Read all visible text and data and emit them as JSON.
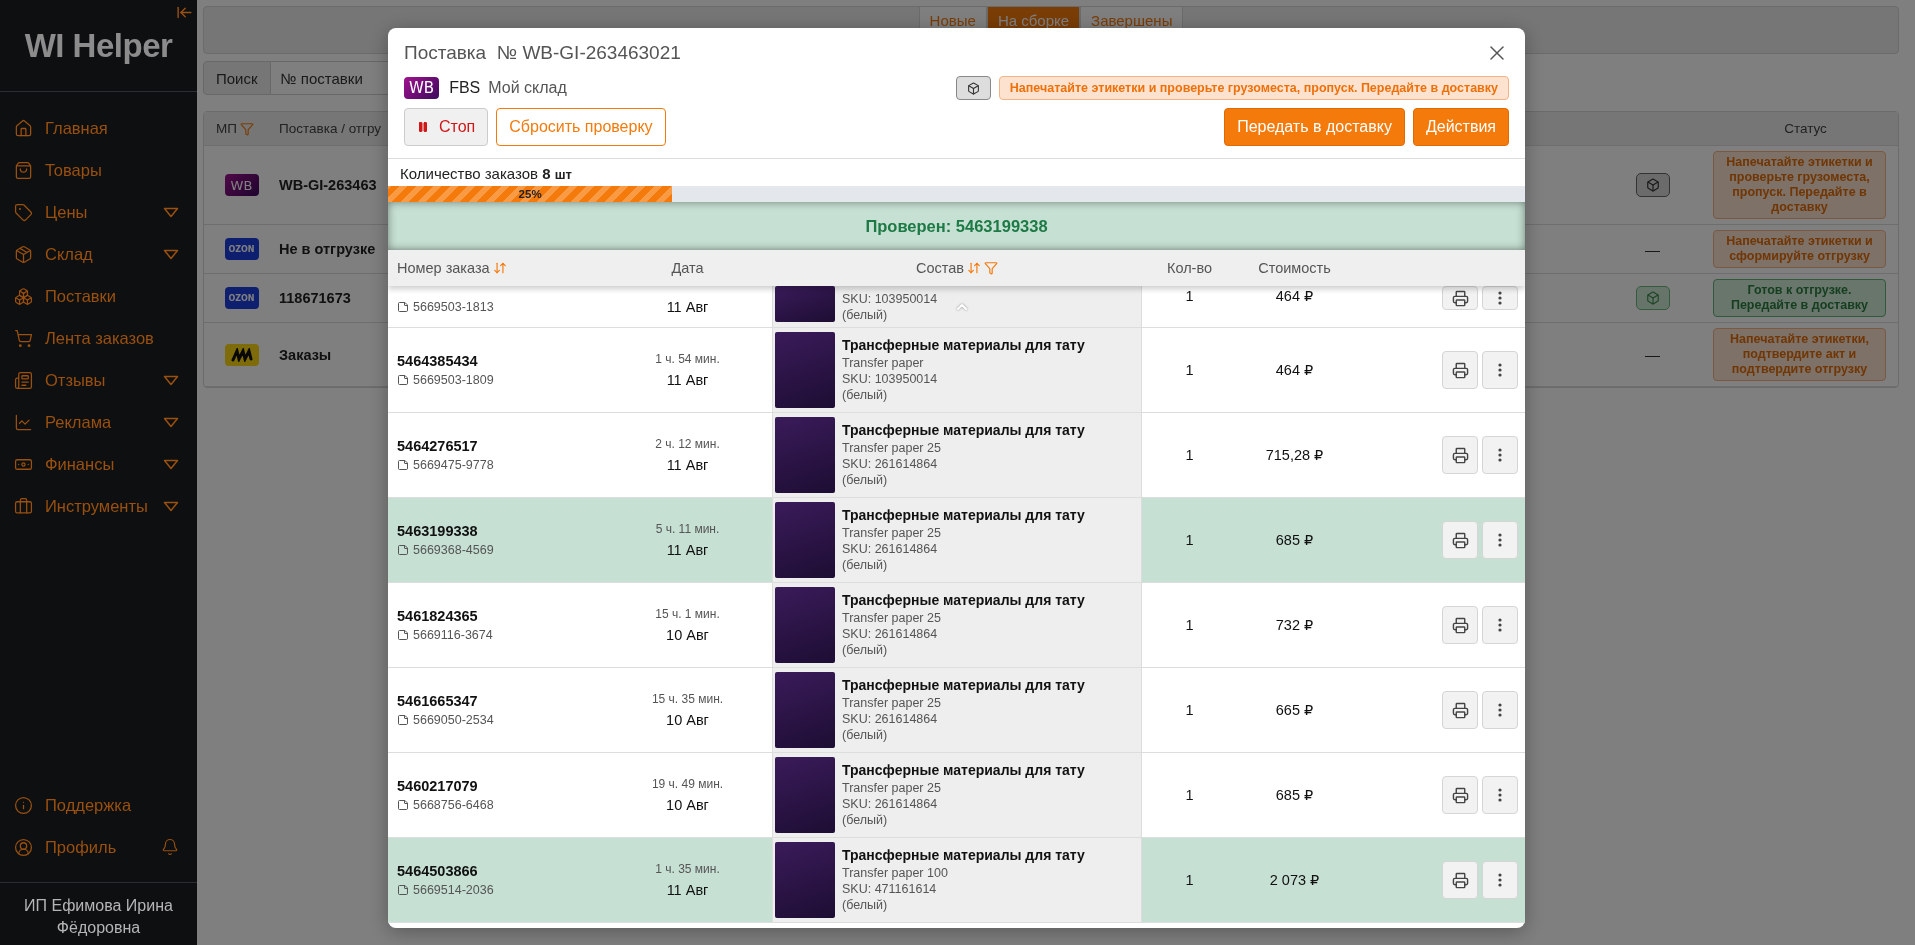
{
  "sidebar": {
    "logo": "WI Helper",
    "items": [
      {
        "label": "Главная",
        "expandable": false
      },
      {
        "label": "Товары",
        "expandable": false
      },
      {
        "label": "Цены",
        "expandable": true
      },
      {
        "label": "Склад",
        "expandable": true
      },
      {
        "label": "Поставки",
        "expandable": false
      },
      {
        "label": "Лента заказов",
        "expandable": false
      },
      {
        "label": "Отзывы",
        "expandable": true
      },
      {
        "label": "Реклама",
        "expandable": true
      },
      {
        "label": "Финансы",
        "expandable": true
      },
      {
        "label": "Инструменты",
        "expandable": true
      }
    ],
    "bottom_items": [
      {
        "label": "Поддержка",
        "bell": false
      },
      {
        "label": "Профиль",
        "bell": true
      }
    ],
    "user": "ИП Ефимова Ирина Фёдоровна"
  },
  "background": {
    "tabs": [
      {
        "label": "Новые",
        "selected": false
      },
      {
        "label": "На сборке",
        "selected": true
      },
      {
        "label": "Завершены",
        "selected": false
      }
    ],
    "search": {
      "button": "Поиск",
      "placeholder": "№ поставки"
    },
    "columns": [
      "МП",
      "Поставка / отгру",
      "Статус"
    ],
    "rows": [
      {
        "logo": {
          "kind": "wb",
          "text": "WB"
        },
        "name": "WB-GI-263463",
        "shipment": {
          "kind": "box"
        },
        "status": {
          "kind": "warning",
          "text": "Напечатайте этикетки и проверьте грузоместа, пропуск. Передайте в доставку"
        }
      },
      {
        "logo": {
          "kind": "ozon",
          "text": "OZON"
        },
        "name": "Не в отгрузке",
        "shipment": {
          "kind": "dash",
          "text": "—"
        },
        "status": {
          "kind": "warning",
          "text": "Напечатайте этикетки и сформируйте отгрузку"
        }
      },
      {
        "logo": {
          "kind": "ozon",
          "text": "OZON"
        },
        "name": "118671673",
        "shipment": {
          "kind": "box"
        },
        "status": {
          "kind": "ready",
          "text": "Готов к отгрузке. Передайте в доставку"
        }
      },
      {
        "logo": {
          "kind": "yandex"
        },
        "name": "Заказы",
        "shipment": {
          "kind": "dash",
          "text": "—"
        },
        "status": {
          "kind": "warning",
          "text": "Напечатайте этикетки, подтвердите акт и подтвердите отгрузку"
        }
      }
    ]
  },
  "modal": {
    "title": "Поставка  № WB-GI-263463021",
    "marketplace": {
      "logo": "WB",
      "scheme": "FBS",
      "warehouse": "Мой склад"
    },
    "alert": "Напечатайте этикетки и проверьте грузоместа, пропуск. Передайте в доставку",
    "buttons_left": [
      {
        "kind": "stop",
        "label": "Стоп"
      },
      {
        "kind": "outline",
        "label": "Сбросить проверку"
      }
    ],
    "buttons_right": [
      {
        "kind": "primary",
        "label": "Передать в доставку"
      },
      {
        "kind": "primary",
        "label": "Действия"
      }
    ],
    "count": {
      "label": "Количество заказов",
      "value": "8",
      "unit": "шт"
    },
    "progress": {
      "level": 0.25,
      "label": "25%"
    },
    "banner": "Проверен: 5463199338",
    "columns": [
      {
        "label": "Номер заказа",
        "sortable": true,
        "filterable": false
      },
      {
        "label": "Дата",
        "sortable": false,
        "filterable": false
      },
      {
        "label": "Состав",
        "sortable": true,
        "filterable": true
      },
      {
        "label": "Кол-во",
        "sortable": false,
        "filterable": false
      },
      {
        "label": "Стоимость",
        "sortable": false,
        "filterable": false
      }
    ],
    "rows": [
      {
        "kind": "partial",
        "checked": false,
        "sub": "5669503-1813",
        "date": "11 Авг",
        "lines": [
          "SKU: 103950014",
          "(белый)"
        ],
        "qty": "1",
        "price": "464 ₽"
      },
      {
        "kind": "full",
        "checked": false,
        "number": "5464385434",
        "sub": "5669503-1809",
        "time": "1 ч. 54 мин.",
        "date": "11 Авг",
        "title": "Трансферные материалы для тату",
        "lines": [
          "Transfer paper",
          "SKU: 103950014",
          "(белый)"
        ],
        "qty": "1",
        "price": "464 ₽"
      },
      {
        "kind": "full",
        "checked": false,
        "number": "5464276517",
        "sub": "5669475-9778",
        "time": "2 ч. 12 мин.",
        "date": "11 Авг",
        "title": "Трансферные материалы для тату",
        "lines": [
          "Transfer paper 25",
          "SKU: 261614864",
          "(белый)"
        ],
        "qty": "1",
        "price": "715,28 ₽"
      },
      {
        "kind": "full",
        "checked": true,
        "number": "5463199338",
        "sub": "5669368-4569",
        "time": "5 ч. 11 мин.",
        "date": "11 Авг",
        "title": "Трансферные материалы для тату",
        "lines": [
          "Transfer paper 25",
          "SKU: 261614864",
          "(белый)"
        ],
        "qty": "1",
        "price": "685 ₽"
      },
      {
        "kind": "full",
        "checked": false,
        "number": "5461824365",
        "sub": "5669116-3674",
        "time": "15 ч. 1 мин.",
        "date": "10 Авг",
        "title": "Трансферные материалы для тату",
        "lines": [
          "Transfer paper 25",
          "SKU: 261614864",
          "(белый)"
        ],
        "qty": "1",
        "price": "732 ₽"
      },
      {
        "kind": "full",
        "checked": false,
        "number": "5461665347",
        "sub": "5669050-2534",
        "time": "15 ч. 35 мин.",
        "date": "10 Авг",
        "title": "Трансферные материалы для тату",
        "lines": [
          "Transfer paper 25",
          "SKU: 261614864",
          "(белый)"
        ],
        "qty": "1",
        "price": "665 ₽"
      },
      {
        "kind": "full",
        "checked": false,
        "number": "5460217079",
        "sub": "5668756-6468",
        "time": "19 ч. 49 мин.",
        "date": "10 Авг",
        "title": "Трансферные материалы для тату",
        "lines": [
          "Transfer paper 25",
          "SKU: 261614864",
          "(белый)"
        ],
        "qty": "1",
        "price": "685 ₽"
      },
      {
        "kind": "full",
        "checked": true,
        "number": "5464503866",
        "sub": "5669514-2036",
        "time": "1 ч. 35 мин.",
        "date": "11 Авг",
        "title": "Трансферные материалы для тату",
        "lines": [
          "Transfer paper 100",
          "SKU: 471161614",
          "(белый)"
        ],
        "qty": "1",
        "price": "2 073 ₽"
      }
    ]
  }
}
